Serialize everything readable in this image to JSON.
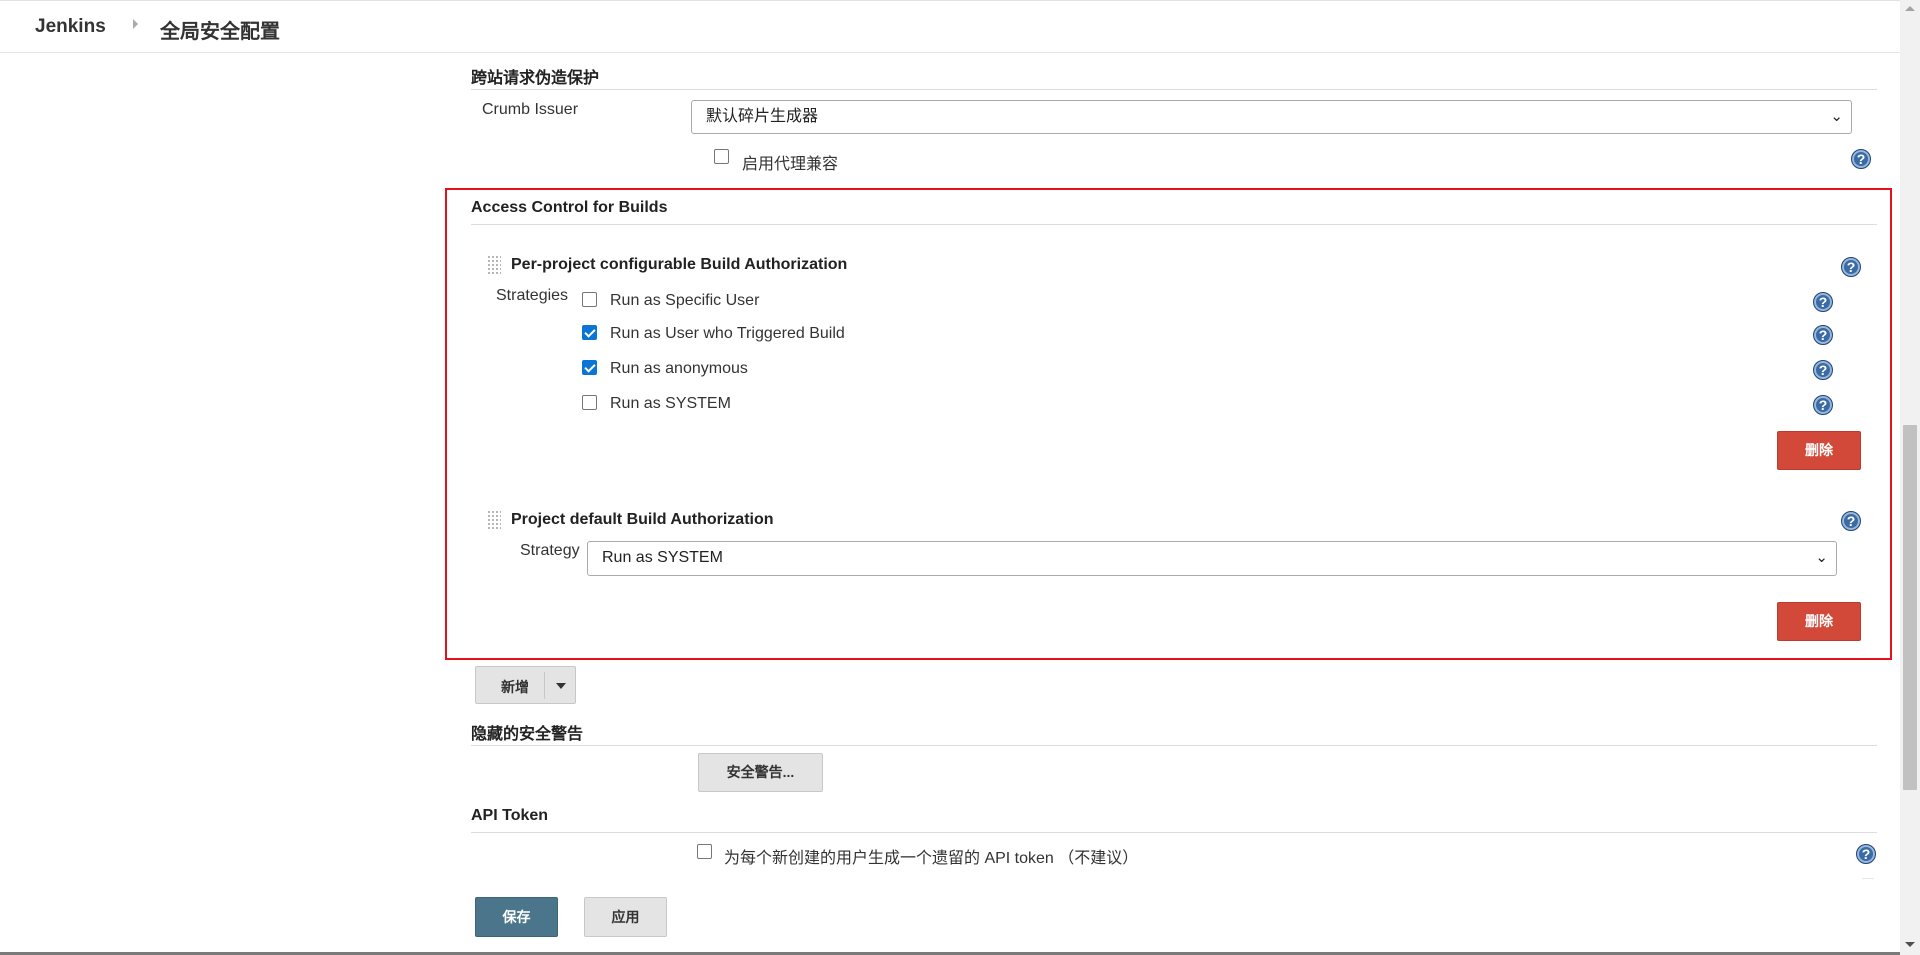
{
  "header": {
    "home": "Jenkins",
    "page_title": "全局安全配置"
  },
  "csrf": {
    "title": "跨站请求伪造保护",
    "crumb_issuer_label": "Crumb Issuer",
    "crumb_issuer_value": "默认碎片生成器",
    "proxy_compat_label": "启用代理兼容",
    "proxy_compat_checked": false
  },
  "access_control": {
    "title": "Access Control for Builds",
    "per_project": {
      "title": "Per-project configurable Build Authorization",
      "strategies_label": "Strategies",
      "strategies": [
        {
          "label": "Run as Specific User",
          "checked": false
        },
        {
          "label": "Run as User who Triggered Build",
          "checked": true
        },
        {
          "label": "Run as anonymous",
          "checked": true
        },
        {
          "label": "Run as SYSTEM",
          "checked": false
        }
      ],
      "delete_label": "删除"
    },
    "project_default": {
      "title": "Project default Build Authorization",
      "strategy_label": "Strategy",
      "strategy_value": "Run as SYSTEM",
      "delete_label": "删除"
    }
  },
  "add_button": {
    "label": "新增"
  },
  "hidden_warnings": {
    "title": "隐藏的安全警告",
    "button_label": "安全警告..."
  },
  "api_token": {
    "title": "API Token",
    "legacy_label": "为每个新创建的用户生成一个遗留的 API token （不建议）",
    "legacy_checked": false
  },
  "footer": {
    "save_label": "保存",
    "apply_label": "应用"
  },
  "colors": {
    "highlight_border": "#e3121a",
    "danger_button": "#d24939",
    "primary_button": "#4b758b",
    "checkbox_checked": "#0a75d5"
  },
  "icons": [
    "help-icon",
    "drag-handle-icon",
    "chevron-down-icon",
    "caret-down-icon"
  ]
}
